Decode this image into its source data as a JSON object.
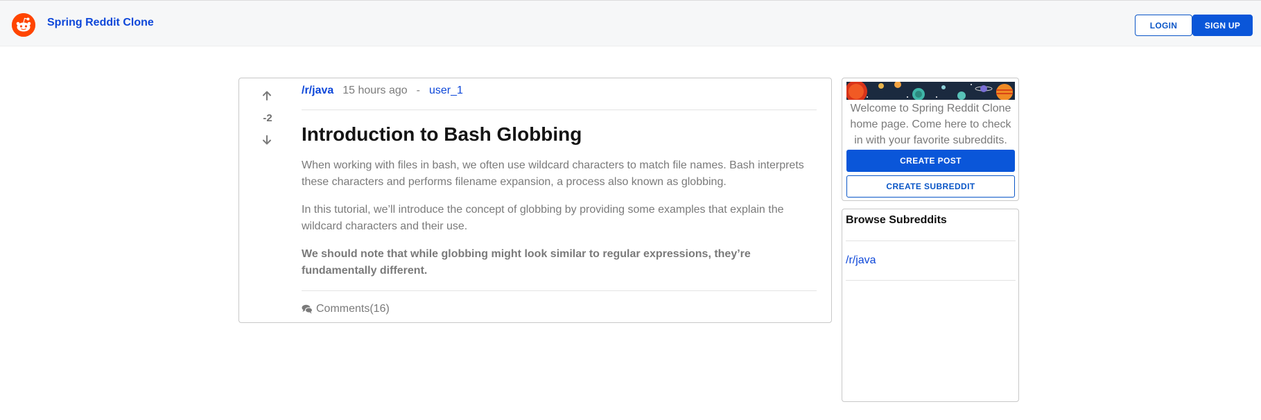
{
  "header": {
    "brand": "Spring Reddit Clone",
    "login_label": "LOGIN",
    "signup_label": "SIGN UP"
  },
  "post": {
    "vote_count": "-2",
    "subreddit": "/r/java",
    "time_ago": "15 hours ago",
    "separator": "-",
    "username": "user_1",
    "title": "Introduction to Bash Globbing",
    "paragraphs": [
      "When working with files in bash, we often use wildcard characters to match file names. Bash interprets these characters and performs filename expansion, a process also known as globbing.",
      "In this tutorial, we’ll introduce the concept of globbing by providing some examples that explain the wildcard characters and their use.",
      "We should note that while globbing might look similar to regular expressions, they’re fundamentally different."
    ],
    "comments_label": "Comments(16)"
  },
  "sidebar": {
    "welcome_text": "Welcome to Spring Reddit Clone home page. Come here to check in with your favorite subreddits.",
    "create_post_label": "CREATE POST",
    "create_subreddit_label": "CREATE SUBREDDIT"
  },
  "browse": {
    "title": "Browse Subreddits",
    "items": [
      "/r/java"
    ]
  },
  "colors": {
    "accent": "#0a56d9",
    "link": "#0d47d9",
    "logo": "#ff4500",
    "muted_text": "#7a7a7a"
  },
  "icons": {
    "logo": "reddit-logo-icon",
    "upvote": "arrow-up-icon",
    "downvote": "arrow-down-icon",
    "comments": "comments-icon"
  }
}
